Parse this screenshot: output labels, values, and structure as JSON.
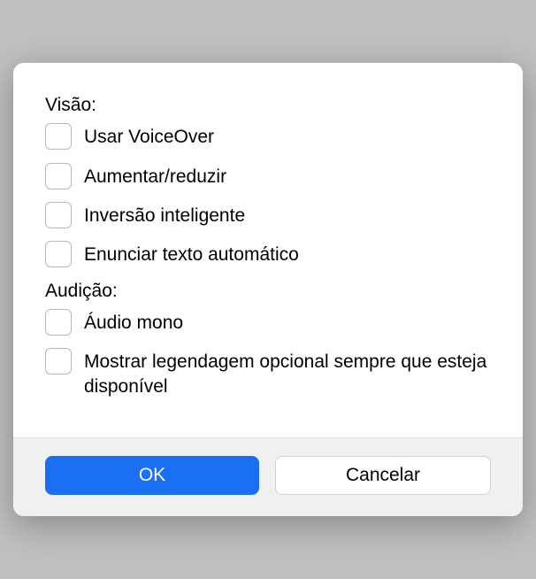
{
  "sections": {
    "vision": {
      "label": "Visão:",
      "items": [
        {
          "label": "Usar VoiceOver",
          "checked": false
        },
        {
          "label": "Aumentar/reduzir",
          "checked": false
        },
        {
          "label": "Inversão inteligente",
          "checked": false
        },
        {
          "label": "Enunciar texto automático",
          "checked": false
        }
      ]
    },
    "hearing": {
      "label": "Audição:",
      "items": [
        {
          "label": "Áudio mono",
          "checked": false
        },
        {
          "label": "Mostrar legendagem opcional sempre que esteja disponível",
          "checked": false
        }
      ]
    }
  },
  "buttons": {
    "ok": "OK",
    "cancel": "Cancelar"
  }
}
